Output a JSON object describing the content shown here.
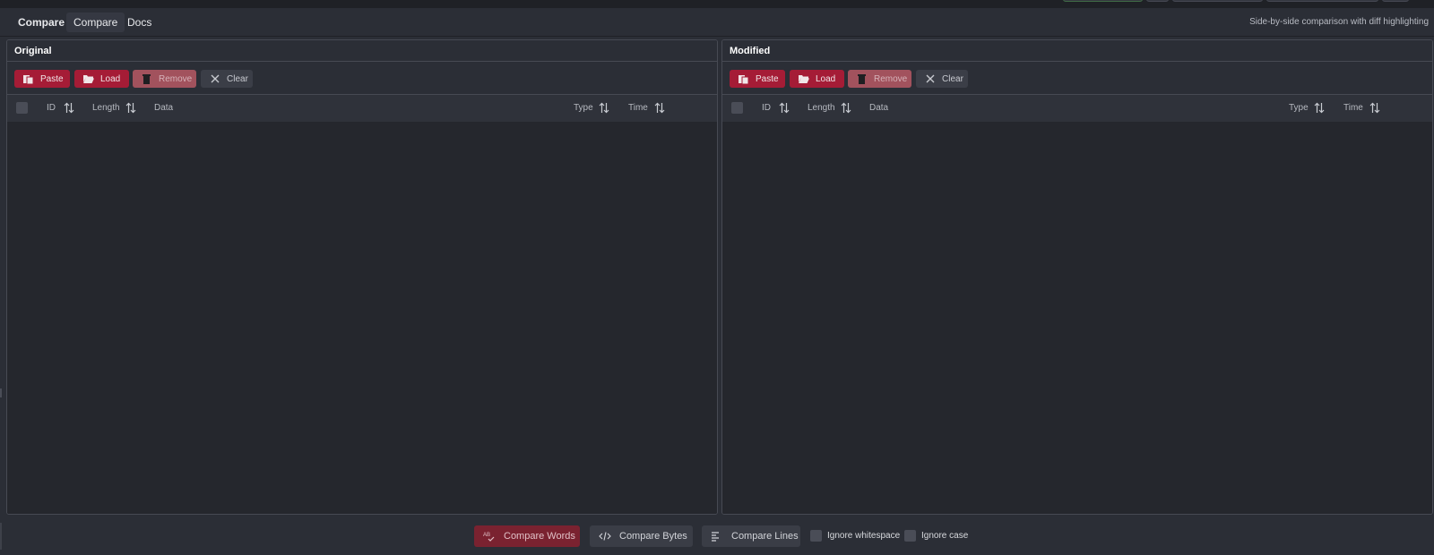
{
  "tabs": [
    {
      "label": "Compare",
      "bold": true
    },
    {
      "label": "Compare",
      "active": true
    },
    {
      "label": "Docs"
    }
  ],
  "subtitle": "Side-by-side comparison with diff highlighting",
  "panels": [
    {
      "title": "Original",
      "buttons": {
        "paste": "Paste",
        "load": "Load",
        "remove": "Remove",
        "clear": "Clear"
      },
      "columns": {
        "id": "ID",
        "length": "Length",
        "data": "Data",
        "type": "Type",
        "time": "Time"
      },
      "rows": []
    },
    {
      "title": "Modified",
      "buttons": {
        "paste": "Paste",
        "load": "Load",
        "remove": "Remove",
        "clear": "Clear"
      },
      "columns": {
        "id": "ID",
        "length": "Length",
        "data": "Data",
        "type": "Type",
        "time": "Time"
      },
      "rows": []
    }
  ],
  "bottom": {
    "compare_words": "Compare Words",
    "compare_bytes": "Compare Bytes",
    "compare_lines": "Compare Lines",
    "ignore_whitespace": "Ignore whitespace",
    "ignore_case": "Ignore case"
  },
  "colors": {
    "accent_red": "#a51c36",
    "remove_rose": "#a2525d",
    "background": "#2b2e36",
    "panel_body": "#25272d"
  },
  "icons": {
    "paste": "clipboard-icon",
    "load": "folder-open-icon",
    "remove": "trash-icon",
    "clear": "close-icon",
    "sort": "sort-arrows-icon",
    "compare_words": "spellcheck-icon",
    "compare_bytes": "code-icon",
    "compare_lines": "align-left-icon"
  }
}
